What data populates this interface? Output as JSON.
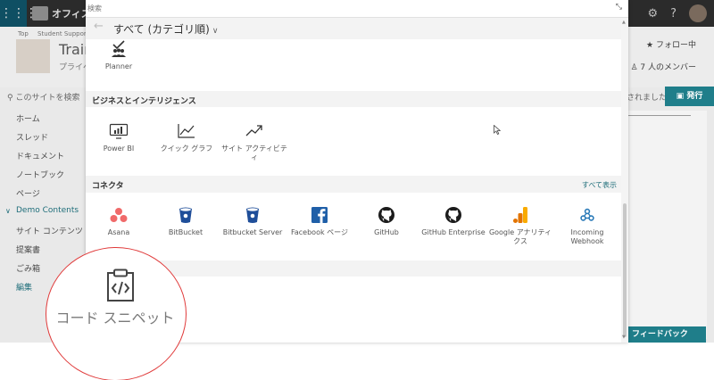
{
  "suite": {
    "app_title": "オフィス"
  },
  "site": {
    "breadcrumbs": [
      "Top",
      "Student Suppor"
    ],
    "title": "Trair",
    "subtitle": "プライベ",
    "follow_label": "フォロー中",
    "members_label": "7 人のメンバー",
    "search_placeholder": "このサイトを検索",
    "saved_label": "されました",
    "publish_label": "発行",
    "feedback_label": "フィードバック"
  },
  "nav": {
    "items": [
      "ホーム",
      "スレッド",
      "ドキュメント",
      "ノートブック",
      "ページ",
      "Demo Contents",
      "サイト コンテンツ",
      "提案書",
      "ごみ箱",
      "編集"
    ],
    "active_index": 5
  },
  "dialog": {
    "search_placeholder": "検索",
    "category_label": "すべて (カテゴリ順)",
    "top_tiles": [
      {
        "label": "Planner",
        "icon": "planner-icon"
      }
    ],
    "sections": [
      {
        "title": "ビジネスとインテリジェンス",
        "tiles": [
          {
            "label": "Power BI",
            "icon": "power-bi-icon"
          },
          {
            "label": "クイック グラフ",
            "icon": "quick-chart-icon"
          },
          {
            "label": "サイト アクティビティ",
            "icon": "site-activity-icon"
          }
        ]
      },
      {
        "title": "コネクタ",
        "see_all": "すべて表示",
        "tiles": [
          {
            "label": "Asana",
            "icon": "asana-icon"
          },
          {
            "label": "BitBucket",
            "icon": "bitbucket-icon"
          },
          {
            "label": "Bitbucket Server",
            "icon": "bitbucket-server-icon"
          },
          {
            "label": "Facebook ページ",
            "icon": "facebook-icon"
          },
          {
            "label": "GitHub",
            "icon": "github-icon"
          },
          {
            "label": "GitHub Enterprise",
            "icon": "github-enterprise-icon"
          },
          {
            "label": "Google アナリティクス",
            "icon": "google-analytics-icon"
          },
          {
            "label": "Incoming Webhook",
            "icon": "incoming-webhook-icon"
          }
        ]
      }
    ]
  },
  "zoom": {
    "label": "コード スニペット",
    "icon": "code-snippet-icon"
  },
  "colors": {
    "accent": "#1f7e8a",
    "callout_ring": "#e03a3a",
    "asana": "#f06a6a",
    "bitbucket": "#2684ff",
    "facebook": "#1877f2",
    "google_analytics": "#f9ab00",
    "webhook": "#2a7ab8"
  }
}
